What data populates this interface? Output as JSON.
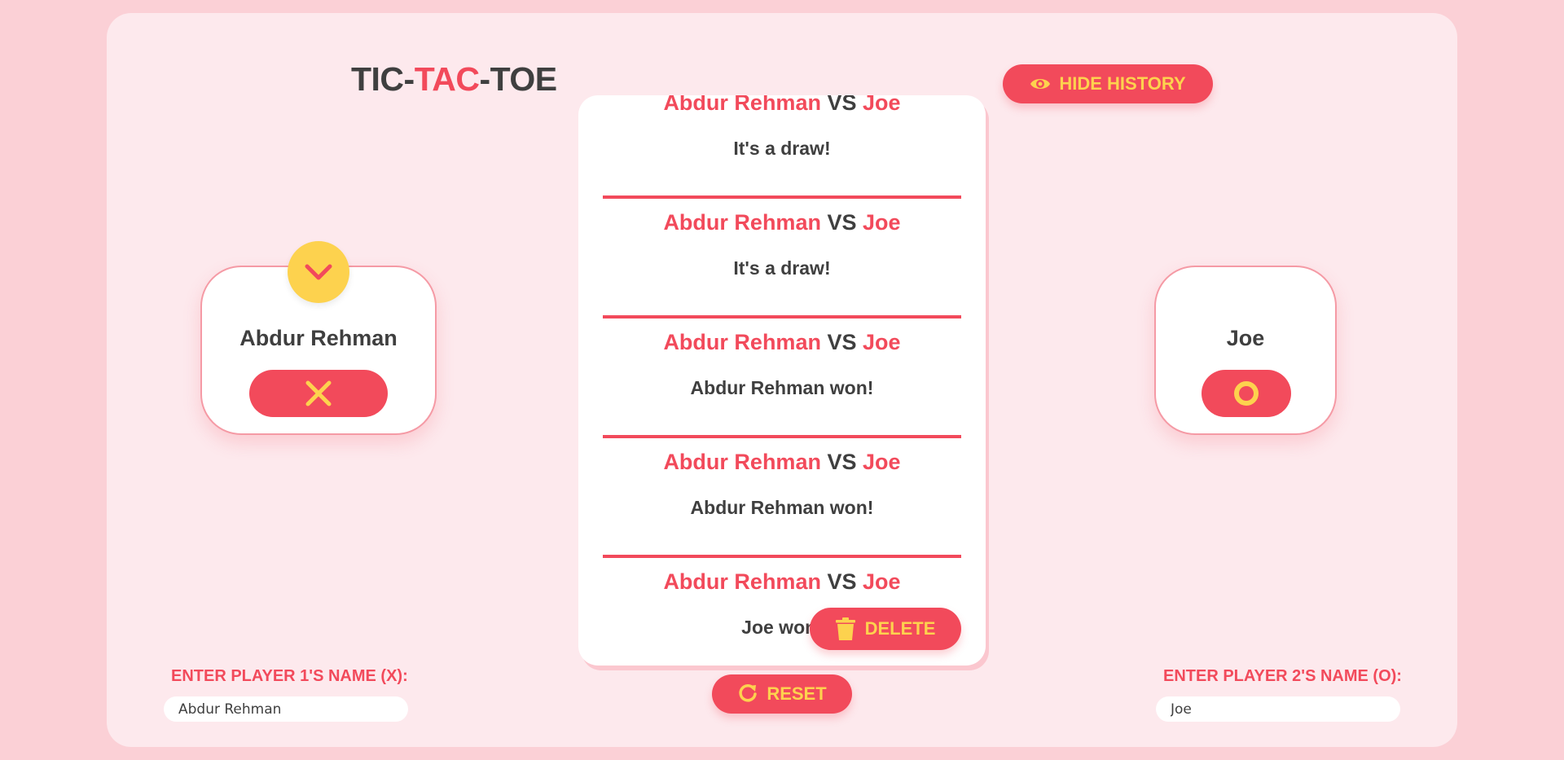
{
  "title": {
    "part1": "TIC-",
    "part2": "TAC",
    "part3": "-TOE"
  },
  "buttons": {
    "hide_history": "HIDE HISTORY",
    "delete": "DELETE",
    "reset": "RESET"
  },
  "players": {
    "p1": {
      "name": "Abdur Rehman",
      "symbol": "X",
      "symbol_icon": "x-icon"
    },
    "p2": {
      "name": "Joe",
      "symbol": "O",
      "symbol_icon": "o-icon"
    },
    "current_turn_icon": "chevron-down-icon"
  },
  "history": [
    {
      "p1": "Abdur Rehman",
      "vs": "VS",
      "p2": "Joe",
      "result": "It's a draw!"
    },
    {
      "p1": "Abdur Rehman",
      "vs": "VS",
      "p2": "Joe",
      "result": "It's a draw!"
    },
    {
      "p1": "Abdur Rehman",
      "vs": "VS",
      "p2": "Joe",
      "result": "Abdur Rehman won!"
    },
    {
      "p1": "Abdur Rehman",
      "vs": "VS",
      "p2": "Joe",
      "result": "Abdur Rehman won!"
    },
    {
      "p1": "Abdur Rehman",
      "vs": "VS",
      "p2": "Joe",
      "result": "Joe won!"
    }
  ],
  "inputs": {
    "p1_label": "ENTER PLAYER 1'S NAME (X):",
    "p1_value": "Abdur Rehman",
    "p2_label": "ENTER PLAYER 2'S NAME (O):",
    "p2_value": "Joe"
  },
  "colors": {
    "accent": "#f24a5b",
    "yellow": "#fdd24e",
    "text": "#3f3f3f",
    "page_bg": "#fbd0d6",
    "panel_bg": "#fde9ed"
  }
}
